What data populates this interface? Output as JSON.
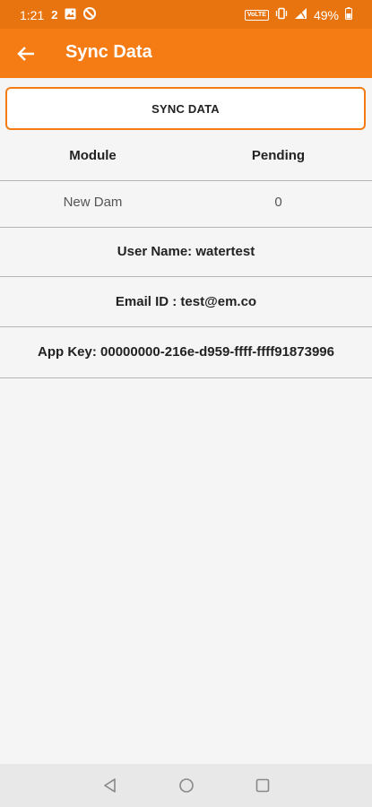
{
  "status_bar": {
    "time": "1:21",
    "notification_count": "2",
    "volte": "VoLTE",
    "battery": "49%"
  },
  "app_bar": {
    "title": "Sync Data"
  },
  "sync_button": {
    "label": "SYNC DATA"
  },
  "table": {
    "headers": [
      "Module",
      "Pending"
    ],
    "rows": [
      {
        "module": "New Dam",
        "pending": "0"
      }
    ]
  },
  "info": {
    "user_name": "User Name: watertest",
    "email": "Email ID : test@em.co",
    "app_key": "App Key: 00000000-216e-d959-ffff-ffff91873996"
  },
  "colors": {
    "app_bar": "#f57c14",
    "status_bar": "#e8740f",
    "background": "#f5f5f5"
  }
}
